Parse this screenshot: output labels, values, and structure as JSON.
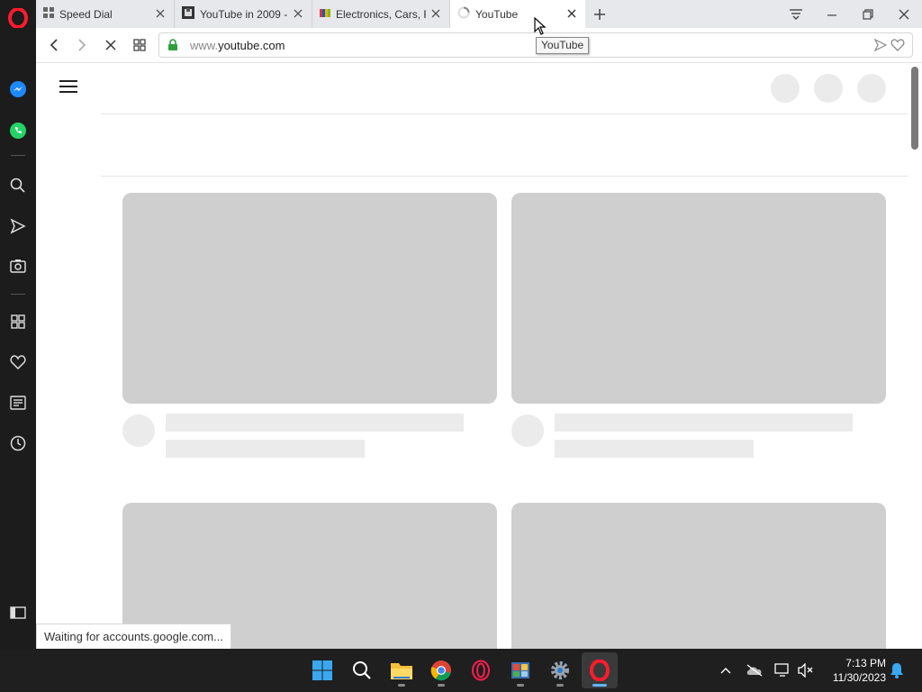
{
  "browser": {
    "tabs": [
      {
        "title": "Speed Dial",
        "icon": "speed-dial-icon"
      },
      {
        "title": "YouTube in 2009 -",
        "icon": "archive-icon"
      },
      {
        "title": "Electronics, Cars, F",
        "icon": "ebay-icon"
      },
      {
        "title": "YouTube",
        "icon": "loading-spinner-icon",
        "active": true
      }
    ],
    "url_sub": "www.",
    "url_main": "youtube.com",
    "tooltip": "YouTube",
    "status_text": "Waiting for accounts.google.com..."
  },
  "taskbar": {
    "time": "7:13 PM",
    "date": "11/30/2023"
  },
  "colors": {
    "opera_red": "#ff1b2d",
    "sidebar_bg": "#1c1c1c",
    "skeleton_dark": "#cfcfcf",
    "skeleton_light": "#ebebeb"
  }
}
